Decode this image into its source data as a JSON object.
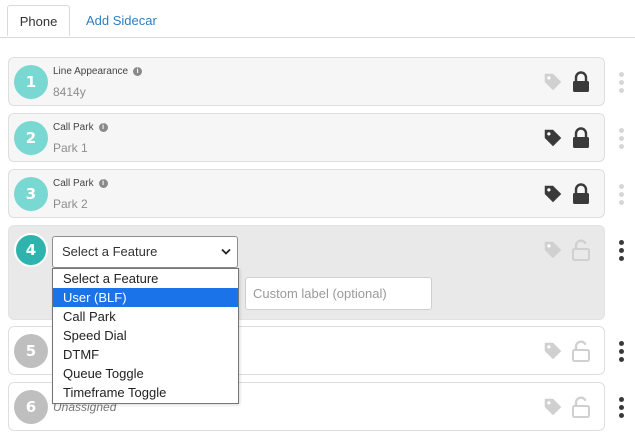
{
  "tabs": [
    {
      "label": "Phone",
      "active": true
    },
    {
      "label": "Add Sidecar",
      "active": false
    }
  ],
  "rows": [
    {
      "number": "1",
      "feature": "Line Appearance",
      "value": "8414y",
      "tag_state": "inactive",
      "lock_state": "locked"
    },
    {
      "number": "2",
      "feature": "Call Park",
      "value": "Park 1",
      "tag_state": "active",
      "lock_state": "locked"
    },
    {
      "number": "3",
      "feature": "Call Park",
      "value": "Park 2",
      "tag_state": "active",
      "lock_state": "locked"
    },
    {
      "number": "4",
      "select_value": "Select a Feature",
      "custom_label_placeholder": "Custom label (optional)",
      "tag_state": "inactive",
      "lock_state": "unlocked"
    },
    {
      "number": "5",
      "value": "",
      "tag_state": "inactive",
      "lock_state": "unlocked"
    },
    {
      "number": "6",
      "value": "Unassigned",
      "tag_state": "inactive",
      "lock_state": "unlocked"
    }
  ],
  "dropdown": {
    "options": [
      "Select a Feature",
      "User (BLF)",
      "Call Park",
      "Speed Dial",
      "DTMF",
      "Queue Toggle",
      "Timeframe Toggle"
    ],
    "highlighted": "User (BLF)"
  },
  "colors": {
    "accent_link": "#2d7fc1",
    "circle_assigned": "#7ad8d3",
    "circle_editing": "#2fb4ad",
    "circle_unassigned": "#bfbfbf",
    "option_highlight": "#1a73e8"
  },
  "icons": [
    "info-icon",
    "tag-icon",
    "lock-icon",
    "unlock-icon",
    "kebab-menu-icon",
    "chevron-down-icon"
  ]
}
